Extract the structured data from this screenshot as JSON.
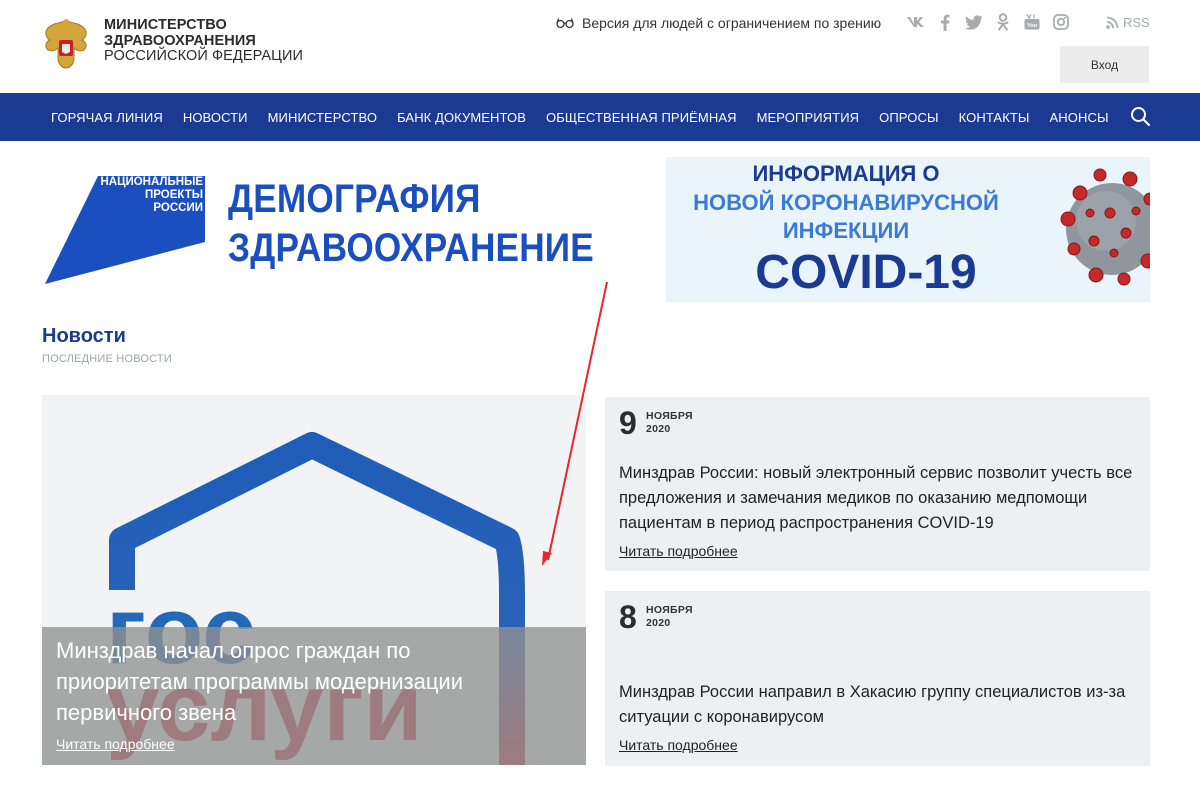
{
  "header": {
    "org_line1": "МИНИСТЕРСТВО",
    "org_line2": "ЗДРАВООХРАНЕНИЯ",
    "org_line3": "РОССИЙСКОЙ ФЕДЕРАЦИИ",
    "vision_label": "Версия для людей с ограничением по зрению",
    "social_icons": [
      "vk-icon",
      "facebook-icon",
      "twitter-icon",
      "odnoklassniki-icon",
      "youtube-icon",
      "instagram-icon"
    ],
    "rss_label": "RSS",
    "login_label": "Вход"
  },
  "nav": {
    "items": [
      "ГОРЯЧАЯ ЛИНИЯ",
      "НОВОСТИ",
      "МИНИСТЕРСТВО",
      "БАНК ДОКУМЕНТОВ",
      "ОБЩЕСТВЕННАЯ ПРИЁМНАЯ",
      "МЕРОПРИЯТИЯ",
      "ОПРОСЫ",
      "КОНТАКТЫ",
      "АНОНСЫ"
    ],
    "search_icon": "search-icon"
  },
  "banners": {
    "np_line1": "НАЦИОНАЛЬНЫЕ",
    "np_line2": "ПРОЕКТЫ",
    "np_line3": "РОССИИ",
    "demography": "ДЕМОГРАФИЯ",
    "healthcare": "ЗДРАВООХРАНЕНИЕ",
    "covid_line1": "ИНФОРМАЦИЯ О",
    "covid_line2": "НОВОЙ КОРОНАВИРУСНОЙ",
    "covid_line3": "ИНФЕКЦИИ",
    "covid_line4": "COVID-19"
  },
  "news": {
    "title": "Новости",
    "subtitle": "ПОСЛЕДНИЕ НОВОСТИ",
    "feature": {
      "title": "Минздрав начал опрос граждан по приоритетам программы модернизации первичного звена",
      "link": "Читать подробнее"
    },
    "items": [
      {
        "day": "9",
        "month": "НОЯБРЯ",
        "year": "2020",
        "text": "Минздрав России: новый электронный сервис позволит учесть все предложения и замечания медиков по оказанию медпомощи пациентам в период распространения COVID-19",
        "link": "Читать подробнее"
      },
      {
        "day": "8",
        "month": "НОЯБРЯ",
        "year": "2020",
        "text": "Минздрав России направил в Хакасию группу специалистов из-за ситуации с коронавирусом",
        "link": "Читать подробнее"
      }
    ]
  },
  "colors": {
    "nav_bg": "#1b3a91",
    "brand_blue": "#1b4fbf",
    "card_bg": "#edf0f3",
    "arrow_red": "#e8262d"
  }
}
